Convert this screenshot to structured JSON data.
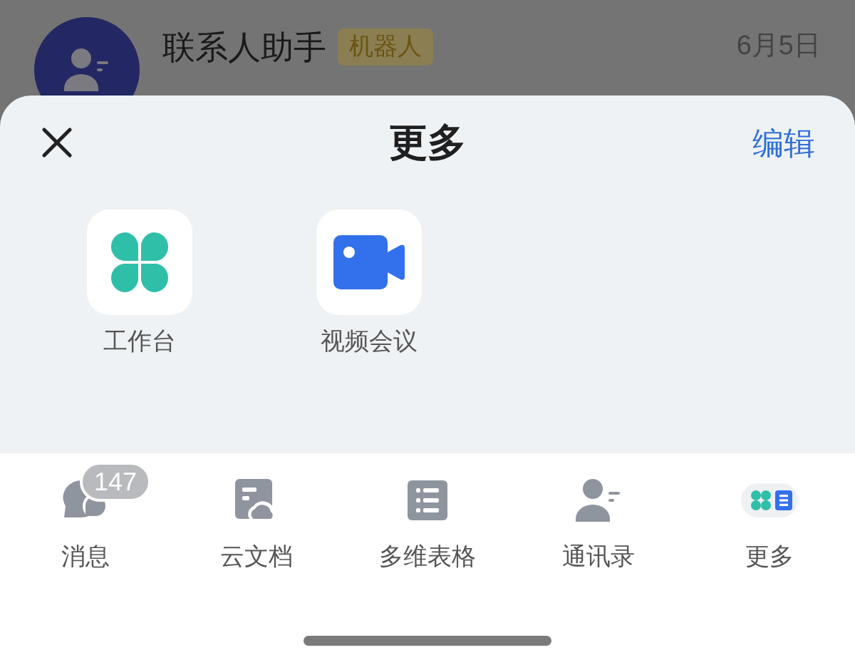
{
  "background_chat": {
    "name": "联系人助手",
    "tag": "机器人",
    "date": "6月5日"
  },
  "sheet": {
    "title": "更多",
    "edit": "编辑",
    "apps": [
      {
        "kind": "workbench",
        "label": "工作台"
      },
      {
        "kind": "video",
        "label": "视频会议"
      }
    ]
  },
  "tab_bar": [
    {
      "kind": "messages",
      "label": "消息",
      "badge": "147"
    },
    {
      "kind": "docs",
      "label": "云文档"
    },
    {
      "kind": "sheets",
      "label": "多维表格"
    },
    {
      "kind": "contacts",
      "label": "通讯录"
    },
    {
      "kind": "more",
      "label": "更多"
    }
  ]
}
